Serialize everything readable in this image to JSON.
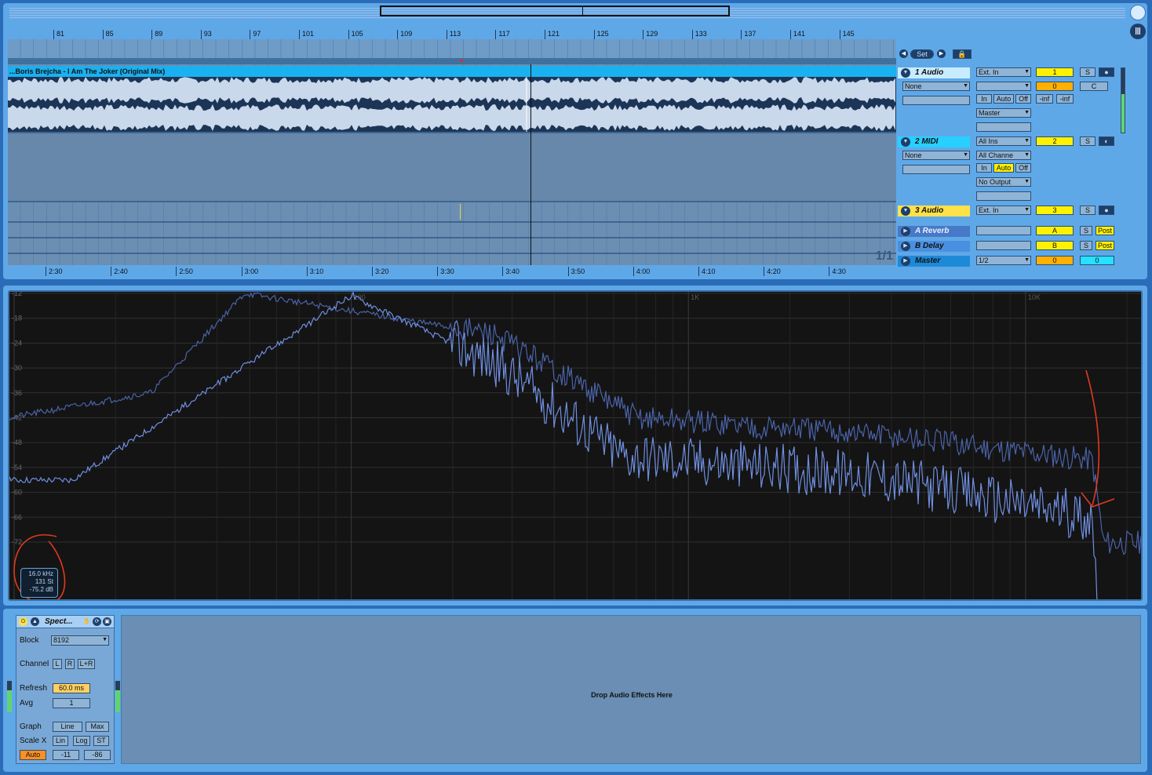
{
  "arrangement": {
    "bar_ticks": [
      "81",
      "85",
      "89",
      "93",
      "97",
      "101",
      "105",
      "109",
      "113",
      "117",
      "121",
      "125",
      "129",
      "133",
      "137",
      "141",
      "145"
    ],
    "time_ticks": [
      "2:30",
      "2:40",
      "2:50",
      "3:00",
      "3:10",
      "3:20",
      "3:30",
      "3:40",
      "3:50",
      "4:00",
      "4:10",
      "4:20",
      "4:30"
    ],
    "clip_name": "...Boris Brejcha - I Am The Joker (Original Mix)",
    "page_count": "1/1",
    "set_label": "Set"
  },
  "mixer": {
    "tracks": [
      {
        "name": "1 Audio",
        "color": "#28d0ff",
        "input_type": "Ext. In",
        "input_channel": "",
        "routing_none": "None",
        "monitor": [
          "In",
          "Auto",
          "Off"
        ],
        "output": "Master",
        "number": "1",
        "solo": "S",
        "volume": "0",
        "pan": "C",
        "peak_l": "-inf",
        "peak_r": "-inf"
      },
      {
        "name": "2 MIDI",
        "color": "#28d0ff",
        "input_type": "All Ins",
        "input_channel": "All Channe",
        "routing_none": "None",
        "monitor": [
          "In",
          "Auto",
          "Off"
        ],
        "output": "No Output",
        "number": "2",
        "solo": "S"
      },
      {
        "name": "3 Audio",
        "color": "#ffe14a",
        "input_type": "Ext. In",
        "number": "3",
        "solo": "S"
      },
      {
        "name": "A Reverb",
        "color": "#4878c8",
        "return_letter": "A",
        "solo": "S",
        "post": "Post"
      },
      {
        "name": "B Delay",
        "color": "#4a90e0",
        "return_letter": "B",
        "solo": "S",
        "post": "Post"
      },
      {
        "name": "Master",
        "color": "#1d8ad8",
        "cue": "1/2",
        "volume": "0",
        "cue_volume": "0"
      }
    ]
  },
  "spectrum": {
    "db_labels": [
      "-12",
      "-18",
      "-24",
      "-30",
      "-36",
      "-42",
      "-48",
      "-54",
      "-60",
      "-66",
      "-72"
    ],
    "freq_labels": [
      "100",
      "1K",
      "10K"
    ],
    "readout": [
      "16.0 kHz",
      "131 St",
      "-75.2 dB"
    ],
    "curve_color": "#6f8fe0",
    "max_curve_color": "#4a63a8"
  },
  "device": {
    "name": "Spect...",
    "block_label": "Block",
    "block_value": "8192",
    "channel_label": "Channel",
    "channel_options": [
      "L",
      "R",
      "L+R"
    ],
    "refresh_label": "Refresh",
    "refresh_value": "60.0 ms",
    "avg_label": "Avg",
    "avg_value": "1",
    "graph_label": "Graph",
    "graph_options": [
      "Line",
      "Max"
    ],
    "scalex_label": "Scale X",
    "scalex_options": [
      "Lin",
      "Log",
      "ST"
    ],
    "auto_label": "Auto",
    "range_high": "-11",
    "range_low": "-86"
  },
  "drop_text": "Drop Audio Effects Here"
}
